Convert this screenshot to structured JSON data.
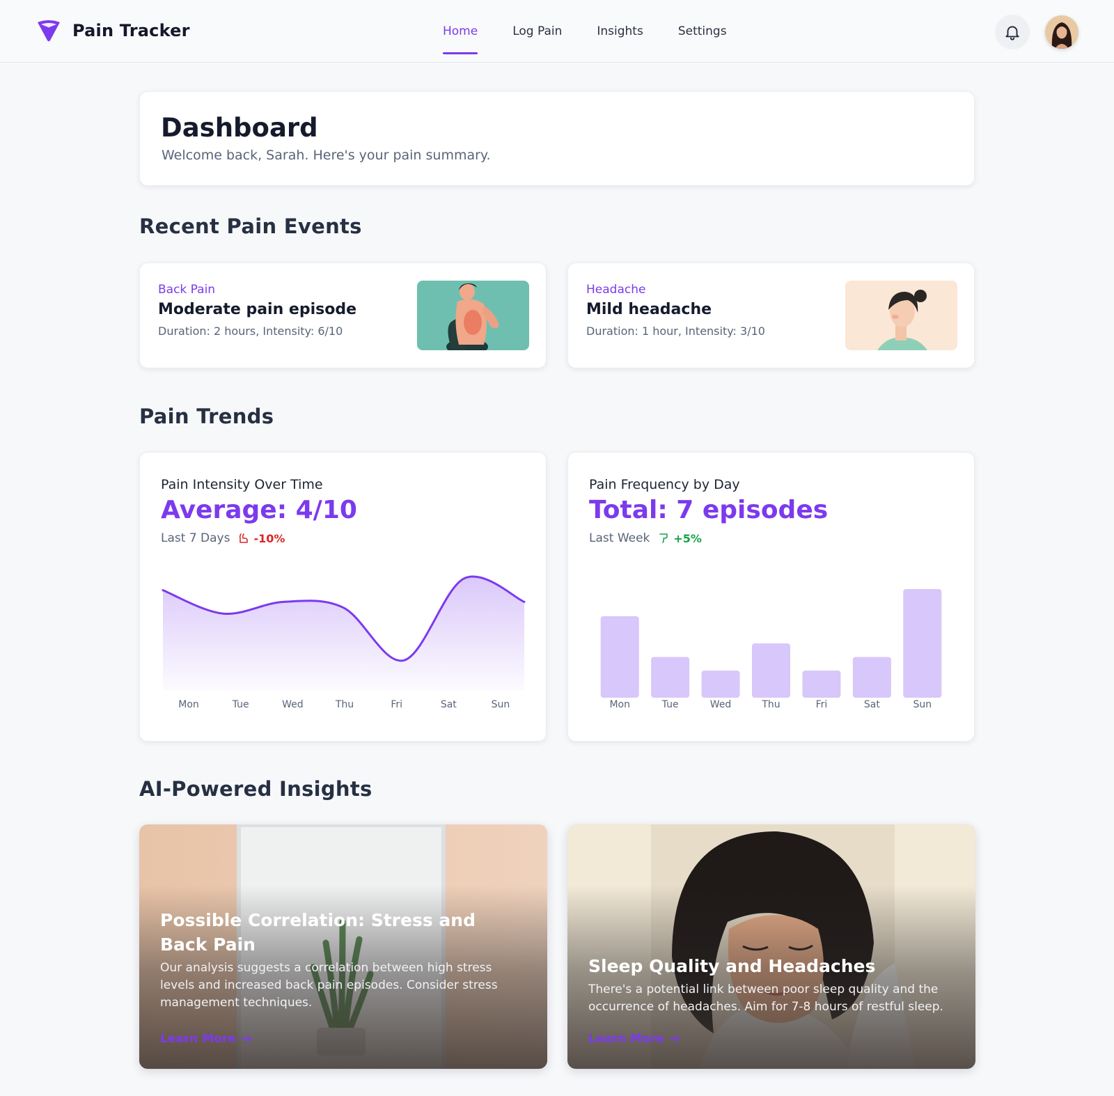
{
  "app": {
    "name": "Pain Tracker",
    "accent": "#7c3aed"
  },
  "nav": {
    "items": [
      {
        "label": "Home",
        "active": true
      },
      {
        "label": "Log Pain",
        "active": false
      },
      {
        "label": "Insights",
        "active": false
      },
      {
        "label": "Settings",
        "active": false
      }
    ],
    "notification_icon": "bell-icon",
    "avatar": "user-avatar"
  },
  "dashboard": {
    "title": "Dashboard",
    "subtitle": "Welcome back, Sarah. Here's your pain summary."
  },
  "sections": {
    "recent": "Recent Pain Events",
    "trends": "Pain Trends",
    "insights": "AI-Powered Insights"
  },
  "events": [
    {
      "type": "Back Pain",
      "title": "Moderate pain episode",
      "meta": "Duration: 2 hours, Intensity: 6/10",
      "image": "back-pain-illustration"
    },
    {
      "type": "Headache",
      "title": "Mild headache",
      "meta": "Duration: 1 hour, Intensity: 3/10",
      "image": "headache-illustration"
    }
  ],
  "trends": {
    "intensity": {
      "title": "Pain Intensity Over Time",
      "big": "Average: 4/10",
      "period": "Last 7 Days",
      "change": "-10%",
      "change_color": "#dc2626"
    },
    "frequency": {
      "title": "Pain Frequency by Day",
      "big": "Total: 7 episodes",
      "period": "Last Week",
      "change": "+5%",
      "change_color": "#16a34a"
    }
  },
  "chart_data": [
    {
      "type": "area",
      "title": "Pain Intensity Over Time",
      "categories": [
        "Mon",
        "Tue",
        "Wed",
        "Thu",
        "Fri",
        "Sat",
        "Sun"
      ],
      "values": [
        8,
        6,
        7,
        6.5,
        2,
        9,
        7
      ],
      "ylim": [
        0,
        10
      ],
      "grid": false,
      "color": "#7c3aed"
    },
    {
      "type": "bar",
      "title": "Pain Frequency by Day",
      "categories": [
        "Mon",
        "Tue",
        "Wed",
        "Thu",
        "Fri",
        "Sat",
        "Sun"
      ],
      "values": [
        6,
        3,
        2,
        4,
        2,
        3,
        8
      ],
      "ylim": [
        0,
        8
      ],
      "grid": false,
      "color": "#d8c7fa"
    }
  ],
  "insights": [
    {
      "title": "Possible Correlation: Stress and Back Pain",
      "body": "Our analysis suggests a correlation between high stress levels and increased back pain episodes. Consider stress management techniques.",
      "link": "Learn More",
      "image": "plant-room-photo"
    },
    {
      "title": "Sleep Quality and Headaches",
      "body": "There's a potential link between poor sleep quality and the occurrence of headaches. Aim for 7-8 hours of restful sleep.",
      "link": "Learn More",
      "image": "sleeping-woman-illustration"
    }
  ]
}
